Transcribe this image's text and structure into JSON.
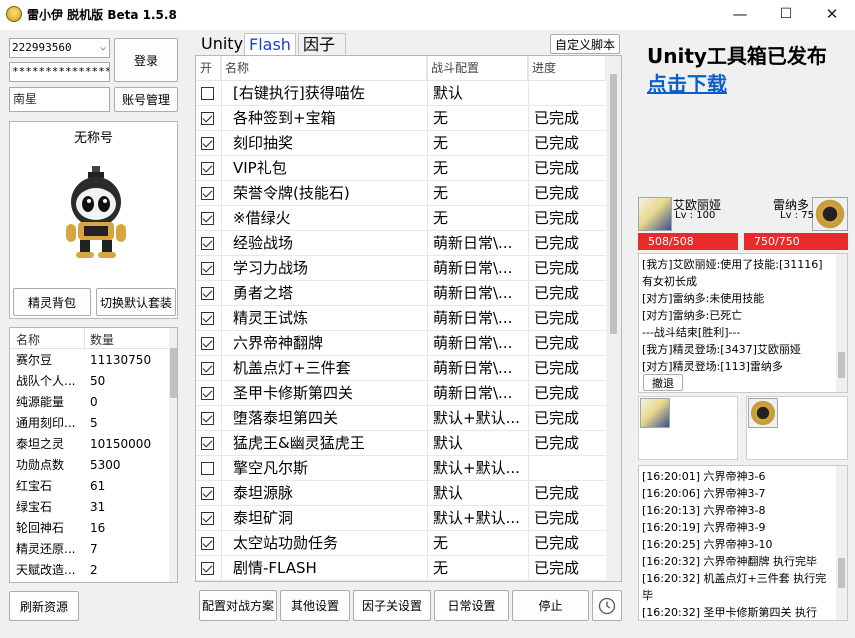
{
  "window": {
    "title": "雷小伊 脱机版 Beta 1.5.8",
    "controls": {
      "minimize": "—",
      "maximize": "☐",
      "close": "✕"
    }
  },
  "login": {
    "account": "222993560",
    "password": "*****************",
    "server": "南星",
    "login_label": "登录",
    "account_manage_label": "账号管理"
  },
  "profile": {
    "name": "无称号",
    "spirit_bag_label": "精灵背包",
    "switch_suit_label": "切换默认套装"
  },
  "resources": {
    "headers": [
      "名称",
      "数量"
    ],
    "rows": [
      {
        "name": "赛尔豆",
        "value": "11130750"
      },
      {
        "name": "战队个人...",
        "value": "50"
      },
      {
        "name": "纯源能量",
        "value": "0"
      },
      {
        "name": "通用刻印...",
        "value": "5"
      },
      {
        "name": "泰坦之灵",
        "value": "10150000"
      },
      {
        "name": "功勋点数",
        "value": "5300"
      },
      {
        "name": "红宝石",
        "value": "61"
      },
      {
        "name": "绿宝石",
        "value": "31"
      },
      {
        "name": "轮回神石",
        "value": "16"
      },
      {
        "name": "精灵还原...",
        "value": "7"
      },
      {
        "name": "天赋改造...",
        "value": "2"
      }
    ],
    "refresh_label": "刷新资源"
  },
  "tabs": [
    {
      "label": "Unity",
      "active": false
    },
    {
      "label": "Flash",
      "active": true
    },
    {
      "label": "因子",
      "active": false
    }
  ],
  "custom_script_label": "自定义脚本",
  "tasks": {
    "headers": {
      "enabled": "开",
      "name": "名称",
      "config": "战斗配置",
      "progress": "进度"
    },
    "rows": [
      {
        "checked": false,
        "name": "[右键执行]获得喵佐",
        "config": "默认",
        "progress": ""
      },
      {
        "checked": true,
        "name": "各种签到+宝箱",
        "config": "无",
        "progress": "已完成"
      },
      {
        "checked": true,
        "name": "刻印抽奖",
        "config": "无",
        "progress": "已完成"
      },
      {
        "checked": true,
        "name": "VIP礼包",
        "config": "无",
        "progress": "已完成"
      },
      {
        "checked": true,
        "name": "荣誉令牌(技能石)",
        "config": "无",
        "progress": "已完成"
      },
      {
        "checked": true,
        "name": "※借绿火",
        "config": "无",
        "progress": "已完成"
      },
      {
        "checked": true,
        "name": "经验战场",
        "config": "萌新日常\\...",
        "progress": "已完成"
      },
      {
        "checked": true,
        "name": "学习力战场",
        "config": "萌新日常\\...",
        "progress": "已完成"
      },
      {
        "checked": true,
        "name": "勇者之塔",
        "config": "萌新日常\\...",
        "progress": "已完成"
      },
      {
        "checked": true,
        "name": "精灵王试炼",
        "config": "萌新日常\\...",
        "progress": "已完成"
      },
      {
        "checked": true,
        "name": "六界帝神翻牌",
        "config": "萌新日常\\...",
        "progress": "已完成"
      },
      {
        "checked": true,
        "name": "机盖点灯+三件套",
        "config": "萌新日常\\...",
        "progress": "已完成"
      },
      {
        "checked": true,
        "name": "圣甲卡修斯第四关",
        "config": "萌新日常\\...",
        "progress": "已完成"
      },
      {
        "checked": true,
        "name": "堕落泰坦第四关",
        "config": "默认+默认...",
        "progress": "已完成"
      },
      {
        "checked": true,
        "name": "猛虎王&幽灵猛虎王",
        "config": "默认",
        "progress": "已完成"
      },
      {
        "checked": false,
        "name": "擎空凡尔斯",
        "config": "默认+默认...",
        "progress": ""
      },
      {
        "checked": true,
        "name": "泰坦源脉",
        "config": "默认",
        "progress": "已完成"
      },
      {
        "checked": true,
        "name": "泰坦矿洞",
        "config": "默认+默认...",
        "progress": "已完成"
      },
      {
        "checked": true,
        "name": "太空站功勋任务",
        "config": "无",
        "progress": "已完成"
      },
      {
        "checked": true,
        "name": "剧情-FLASH",
        "config": "无",
        "progress": "已完成"
      }
    ]
  },
  "bottom_buttons": {
    "battle_plan": "配置对战方案",
    "other_settings": "其他设置",
    "factor_settings": "因子关设置",
    "daily_settings": "日常设置",
    "stop": "停止",
    "timer_icon": "clock-icon"
  },
  "ad": {
    "title": "Unity工具箱已发布",
    "link": "点击下载"
  },
  "battle": {
    "ally": {
      "name": "艾欧丽娅",
      "level": "Lv : 100",
      "hp": "508/508"
    },
    "enemy": {
      "name": "雷纳多",
      "level": "Lv : 75",
      "hp": "750/750"
    },
    "log": [
      "[我方]艾欧丽娅:使用了技能:[31116]",
      "有女初长成",
      "[对方]雷纳多:未使用技能",
      "[对方]雷纳多:已死亡",
      "---战斗结束[胜利]---",
      "[我方]精灵登场:[3437]艾欧丽娅",
      "[对方]精灵登场:[113]雷纳多"
    ],
    "retreat_label": "撤退"
  },
  "exec_log": [
    "[16:20:01] 六界帝神3-6",
    "[16:20:06] 六界帝神3-7",
    "[16:20:13] 六界帝神3-8",
    "[16:20:19] 六界帝神3-9",
    "[16:20:25] 六界帝神3-10",
    "[16:20:32] 六界帝神翻牌 执行完毕",
    "[16:20:32] 机盖点灯+三件套 执行完毕",
    "[16:20:32] 圣甲卡修斯第四关 执行"
  ],
  "colors": {
    "hp_bar": "#e82a2a",
    "link": "#0b5fc6",
    "active_tab": "#1a3fd6"
  }
}
